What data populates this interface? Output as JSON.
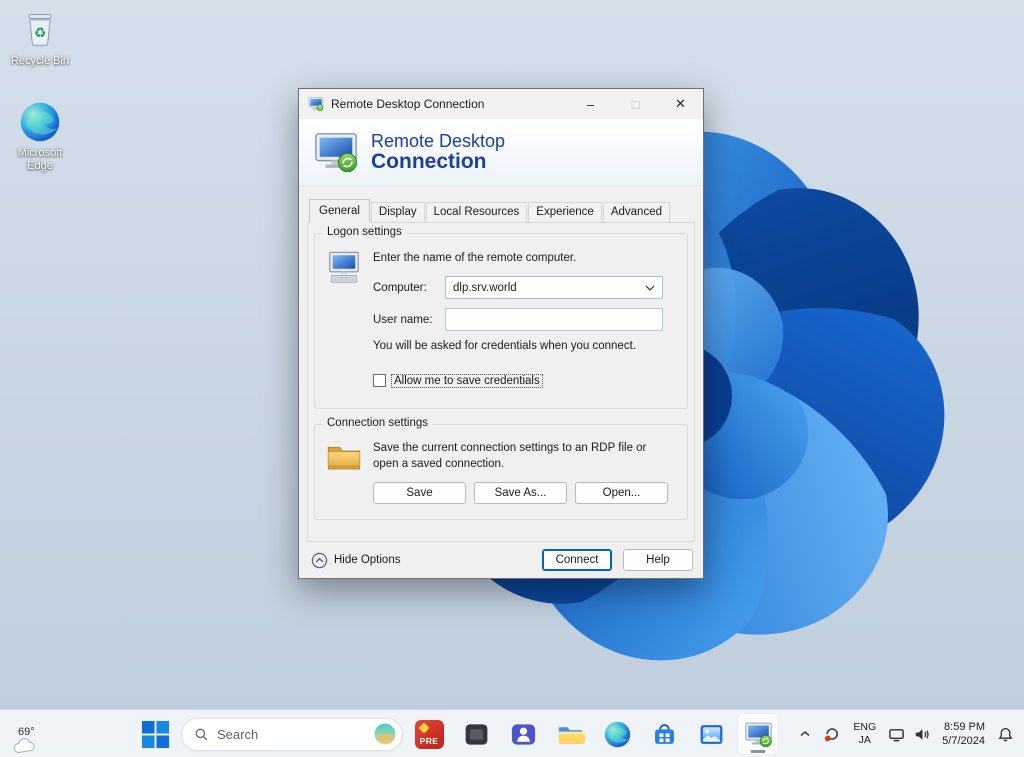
{
  "desktop": {
    "icons": [
      {
        "label": "Recycle Bin"
      },
      {
        "label": "Microsoft Edge"
      }
    ]
  },
  "window": {
    "title": "Remote Desktop Connection",
    "controls": {
      "minimize": "–",
      "maximize": "□",
      "close": "✕"
    }
  },
  "branding": {
    "line1": "Remote Desktop",
    "line2": "Connection"
  },
  "tabs": [
    {
      "label": "General",
      "active": true
    },
    {
      "label": "Display",
      "active": false
    },
    {
      "label": "Local Resources",
      "active": false
    },
    {
      "label": "Experience",
      "active": false
    },
    {
      "label": "Advanced",
      "active": false
    }
  ],
  "logon": {
    "group_title": "Logon settings",
    "instruction": "Enter the name of the remote computer.",
    "computer_label": "Computer:",
    "computer_value": "dlp.srv.world",
    "username_label": "User name:",
    "username_value": "",
    "note": "You will be asked for credentials when you connect.",
    "save_credentials_label": "Allow me to save credentials",
    "save_credentials_checked": false
  },
  "connection": {
    "group_title": "Connection settings",
    "description": "Save the current connection settings to an RDP file or open a saved connection.",
    "buttons": {
      "save": "Save",
      "save_as": "Save As...",
      "open": "Open..."
    }
  },
  "footer": {
    "hide_options": "Hide Options",
    "connect": "Connect",
    "help": "Help"
  },
  "taskbar": {
    "weather_temp": "69°",
    "search_placeholder": "Search",
    "pre_label": "PRE",
    "apps": [
      "start",
      "search",
      "pre-app",
      "dark-app",
      "teams",
      "file-explorer",
      "edge",
      "microsoft-store",
      "gallery",
      "remote-desktop"
    ],
    "active_app": "remote-desktop",
    "tray": {
      "language_top": "ENG",
      "language_bottom": "JA",
      "time": "8:59 PM",
      "date": "5/7/2024"
    }
  },
  "icons": {
    "recycle_glyph": "♻"
  },
  "colors": {
    "accent_blue": "#0067c0",
    "brand_blue": "#1d3f9c",
    "badge_red": "#d83b01"
  }
}
